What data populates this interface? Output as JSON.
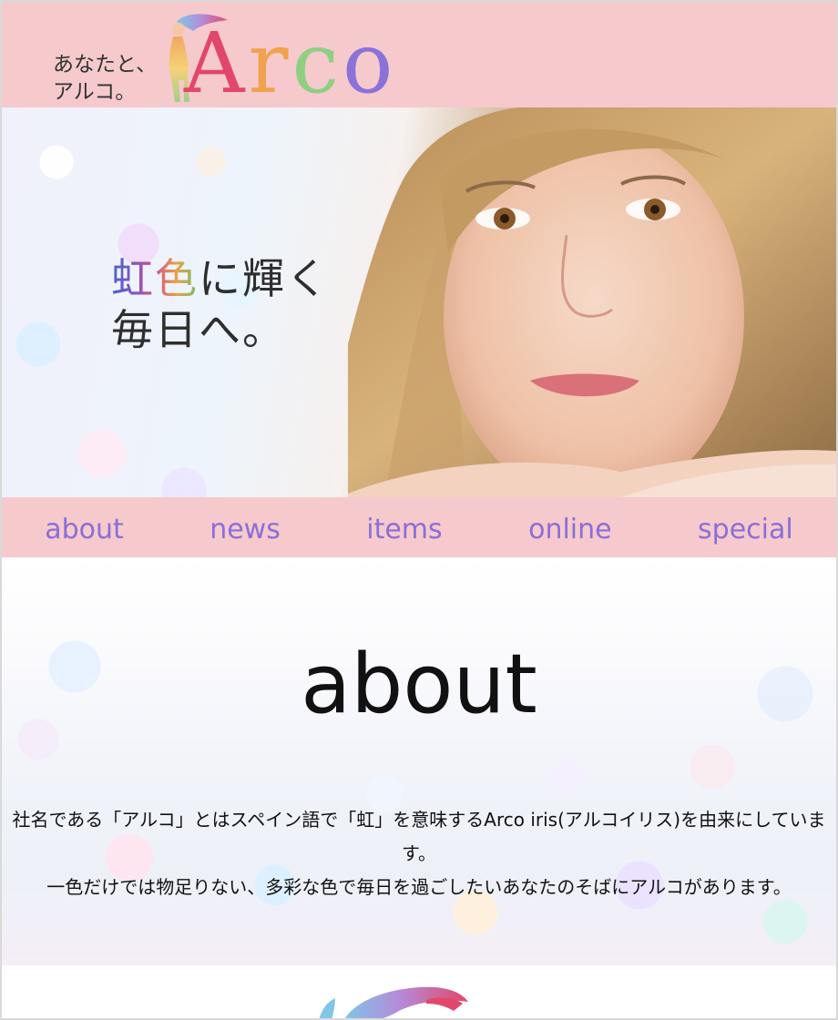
{
  "header": {
    "tagline_line1": "あなたと、",
    "tagline_line2": "アルコ。",
    "logo_letters": [
      {
        "char": "A",
        "color": "#e2476b"
      },
      {
        "char": "r",
        "color": "#f0a24c"
      },
      {
        "char": "c",
        "color": "#8fcf82"
      },
      {
        "char": "o",
        "color": "#8b72d8"
      }
    ],
    "background_color": "#f6c9cd"
  },
  "hero": {
    "line1_rainbow": "虹色",
    "line1_rest": "に輝く",
    "line2": "毎日へ。"
  },
  "nav": {
    "items": [
      {
        "label": "about"
      },
      {
        "label": "news"
      },
      {
        "label": "items"
      },
      {
        "label": "online"
      },
      {
        "label": "special"
      }
    ],
    "text_color": "#8a6fd6"
  },
  "about": {
    "title": "about",
    "paragraph1": "社名である「アルコ」とはスペイン語で「虹」を意味するArco iris(アルコイリス)を由来にしています。",
    "paragraph2": "一色だけでは物足りない、多彩な色で毎日を過ごしたいあなたのそばにアルコがあります。"
  }
}
